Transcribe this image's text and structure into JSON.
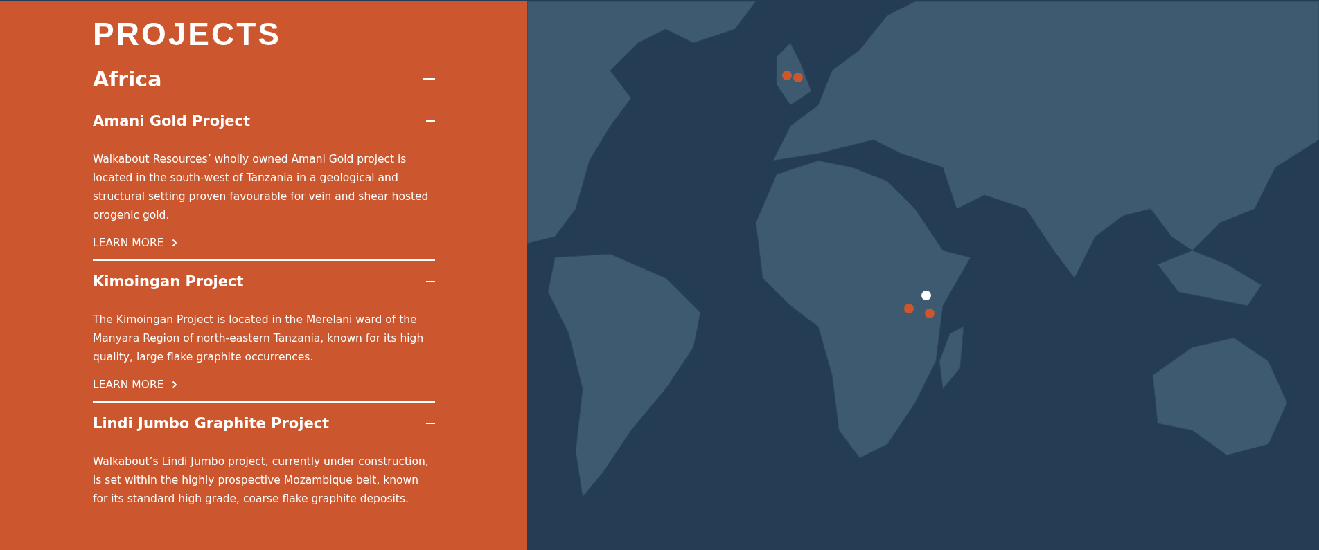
{
  "title": "PROJECTS",
  "region": {
    "name": "Africa",
    "expanded": true
  },
  "projects": [
    {
      "name": "Amani Gold Project",
      "expanded": true,
      "description": "Walkabout Resources’ wholly owned Amani Gold project is located in the south-west of Tanzania in a geological and structural setting proven favourable for vein and shear hosted orogenic gold.",
      "link": "LEARN MORE"
    },
    {
      "name": "Kimoingan Project",
      "expanded": true,
      "description": "The Kimoingan Project is located in the Merelani ward of the Manyara Region of north-eastern Tanzania, known for its high quality, large flake graphite occurrences.",
      "link": "LEARN MORE"
    },
    {
      "name": "Lindi Jumbo Graphite Project",
      "expanded": true,
      "description": "Walkabout’s Lindi Jumbo project, currently under construction, is set within the highly prospective Mozambique belt, known for its standard high grade, coarse flake graphite deposits."
    }
  ],
  "map_markers": [
    {
      "selected": false
    },
    {
      "selected": false
    },
    {
      "selected": true
    },
    {
      "selected": false
    },
    {
      "selected": false
    }
  ]
}
